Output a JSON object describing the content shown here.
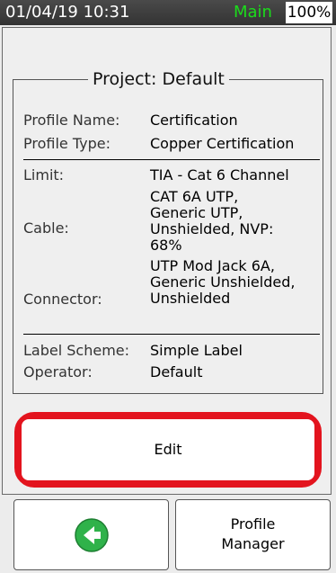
{
  "status_bar": {
    "datetime": "01/04/19 10:31",
    "mode": "Main",
    "battery": "100%"
  },
  "project": {
    "title": "Project: Default"
  },
  "profile": {
    "name_label": "Profile Name:",
    "name_value": "Certification",
    "type_label": "Profile Type:",
    "type_value": "Copper Certification"
  },
  "test_settings": {
    "limit_label": "Limit:",
    "limit_value": "TIA - Cat 6 Channel",
    "cable_label": "Cable:",
    "cable_value_lines": [
      "CAT 6A UTP,",
      "Generic UTP,",
      "Unshielded, NVP:",
      "68%"
    ],
    "connector_label": "Connector:",
    "connector_value_lines": [
      "UTP Mod Jack 6A,",
      "Generic Unshielded,",
      "Unshielded"
    ]
  },
  "misc": {
    "label_scheme_label": "Label Scheme:",
    "label_scheme_value": "Simple Label",
    "operator_label": "Operator:",
    "operator_value": "Default"
  },
  "actions": {
    "edit_label": "Edit",
    "profile_manager_label": "Profile\nManager",
    "back_icon": "back-arrow-icon"
  },
  "colors": {
    "status_mode": "#1bdc1b",
    "highlight": "#e3141e",
    "back_icon": "#2fb24a"
  }
}
